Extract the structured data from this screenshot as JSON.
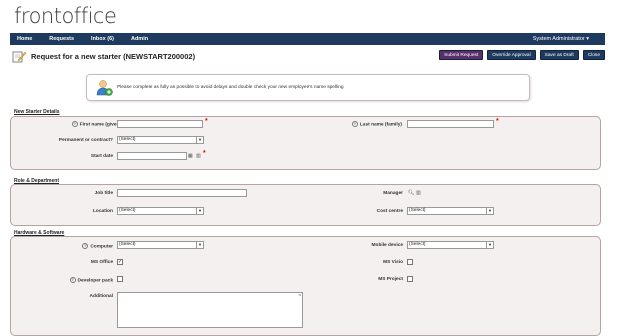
{
  "app": {
    "logo": "frontoffice"
  },
  "nav": {
    "home": "Home",
    "requests": "Requests",
    "inbox": "Inbox (6)",
    "admin": "Admin",
    "user": "System Administrator ▾"
  },
  "page": {
    "title": "Request for a new starter (NEWSTART200002)"
  },
  "toolbar": {
    "submit": "Submit Request",
    "override": "Override Approval",
    "save_draft": "Save as Draft",
    "close": "Close"
  },
  "message": "Please complete as fully as possible to avoid delays and double check your new employee's name spelling",
  "sections": {
    "new_starter": {
      "title": "New Starter Details",
      "first_name_label": "First name (given)",
      "last_name_label": "Last name (family)",
      "perm_label": "Permanent or contract?",
      "perm_value": "(Select)",
      "start_label": "Start date"
    },
    "role": {
      "title": "Role & Department",
      "job_label": "Job title",
      "manager_label": "Manager",
      "location_label": "Location",
      "location_value": "(Select)",
      "cost_label": "Cost centre",
      "cost_value": "(Select)"
    },
    "hardware": {
      "title": "Hardware & Software",
      "computer_label": "Computer",
      "computer_value": "(Select)",
      "mobile_label": "Mobile device",
      "mobile_value": "(Select)",
      "office_label": "MS Office",
      "office_checked": true,
      "visio_label": "MS Visio",
      "visio_checked": false,
      "devpack_label": "Developer pack",
      "devpack_checked": false,
      "project_label": "MS Project",
      "project_checked": false,
      "additional_label": "Additional"
    }
  },
  "colors": {
    "nav": "#1e3a5f",
    "submit": "#5a2e6a",
    "panel": "#f5f0f0",
    "required": "#e00000"
  }
}
